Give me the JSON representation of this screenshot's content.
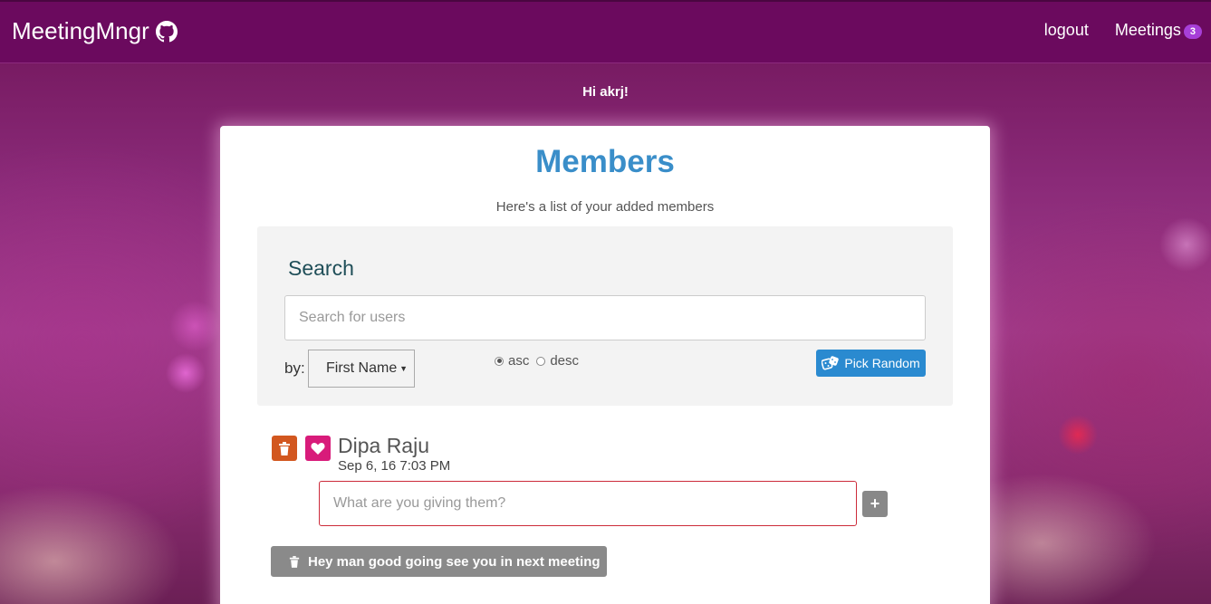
{
  "navbar": {
    "brand": "MeetingMngr",
    "brand_icon": "github-icon",
    "links": {
      "logout": "logout",
      "meetings": "Meetings",
      "meetings_badge": "3"
    }
  },
  "greeting": "Hi akrj!",
  "card": {
    "title": "Members",
    "subtitle": "Here's a list of your added members"
  },
  "search": {
    "heading": "Search",
    "placeholder": "Search for users",
    "by_label": "by:",
    "sort_field": "First Name",
    "order_options": [
      {
        "label": "asc",
        "checked": true
      },
      {
        "label": "desc",
        "checked": false
      }
    ],
    "pick_random_label": "Pick Random"
  },
  "members": [
    {
      "name": "Dipa Raju",
      "date": "Sep 6, 16 7:03 PM",
      "gift_placeholder": "What are you giving them?",
      "add_label": "+",
      "gifts": [
        "Hey man good going see you in next meeting"
      ]
    }
  ],
  "colors": {
    "navbar": "#6b0a5e",
    "title": "#3a8ec9",
    "pick_random": "#2a8ad0",
    "delete": "#d2571f",
    "favorite": "#d81b7a",
    "badge": "#a73fd8"
  }
}
